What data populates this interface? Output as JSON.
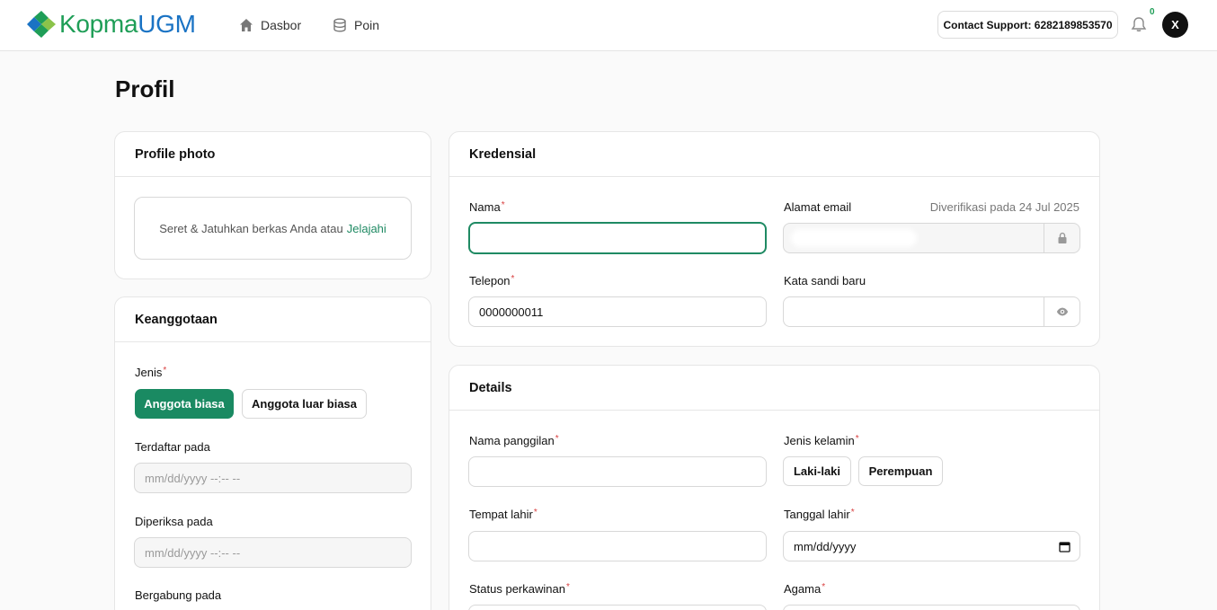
{
  "brand": {
    "part1": "Kopma",
    "part2": "UGM"
  },
  "nav": [
    {
      "label": "Dasbor",
      "icon": "home-icon"
    },
    {
      "label": "Poin",
      "icon": "database-icon"
    }
  ],
  "support_label": "Contact Support: 6282189853570",
  "notifications_count": "0",
  "avatar_initial": "X",
  "page_title": "Profil",
  "profile_photo": {
    "title": "Profile photo",
    "drop_text": "Seret & Jatuhkan berkas Anda atau",
    "browse_link": "Jelajahi"
  },
  "membership": {
    "title": "Keanggotaan",
    "type_label": "Jenis",
    "type_options": [
      "Anggota biasa",
      "Anggota luar biasa"
    ],
    "selected_type": "Anggota biasa",
    "registered_label": "Terdaftar pada",
    "registered_placeholder": "mm/dd/yyyy --:-- --",
    "checked_label": "Diperiksa pada",
    "checked_placeholder": "mm/dd/yyyy --:-- --",
    "joined_label": "Bergabung pada"
  },
  "credentials": {
    "title": "Kredensial",
    "name_label": "Nama",
    "name_value": "",
    "email_label": "Alamat email",
    "email_verified": "Diverifikasi pada 24 Jul 2025",
    "phone_label": "Telepon",
    "phone_value": "0000000011",
    "password_label": "Kata sandi baru",
    "password_value": ""
  },
  "details": {
    "title": "Details",
    "nickname_label": "Nama panggilan",
    "gender_label": "Jenis kelamin",
    "gender_options": [
      "Laki-laki",
      "Perempuan"
    ],
    "birthplace_label": "Tempat lahir",
    "birthdate_label": "Tanggal lahir",
    "birthdate_placeholder": "mm/dd/yyyy",
    "marital_label": "Status perkawinan",
    "religion_label": "Agama"
  },
  "colors": {
    "accent": "#1a8a62",
    "brand_green": "#1f9e57",
    "brand_blue": "#1a73c4",
    "required": "#d94040"
  }
}
